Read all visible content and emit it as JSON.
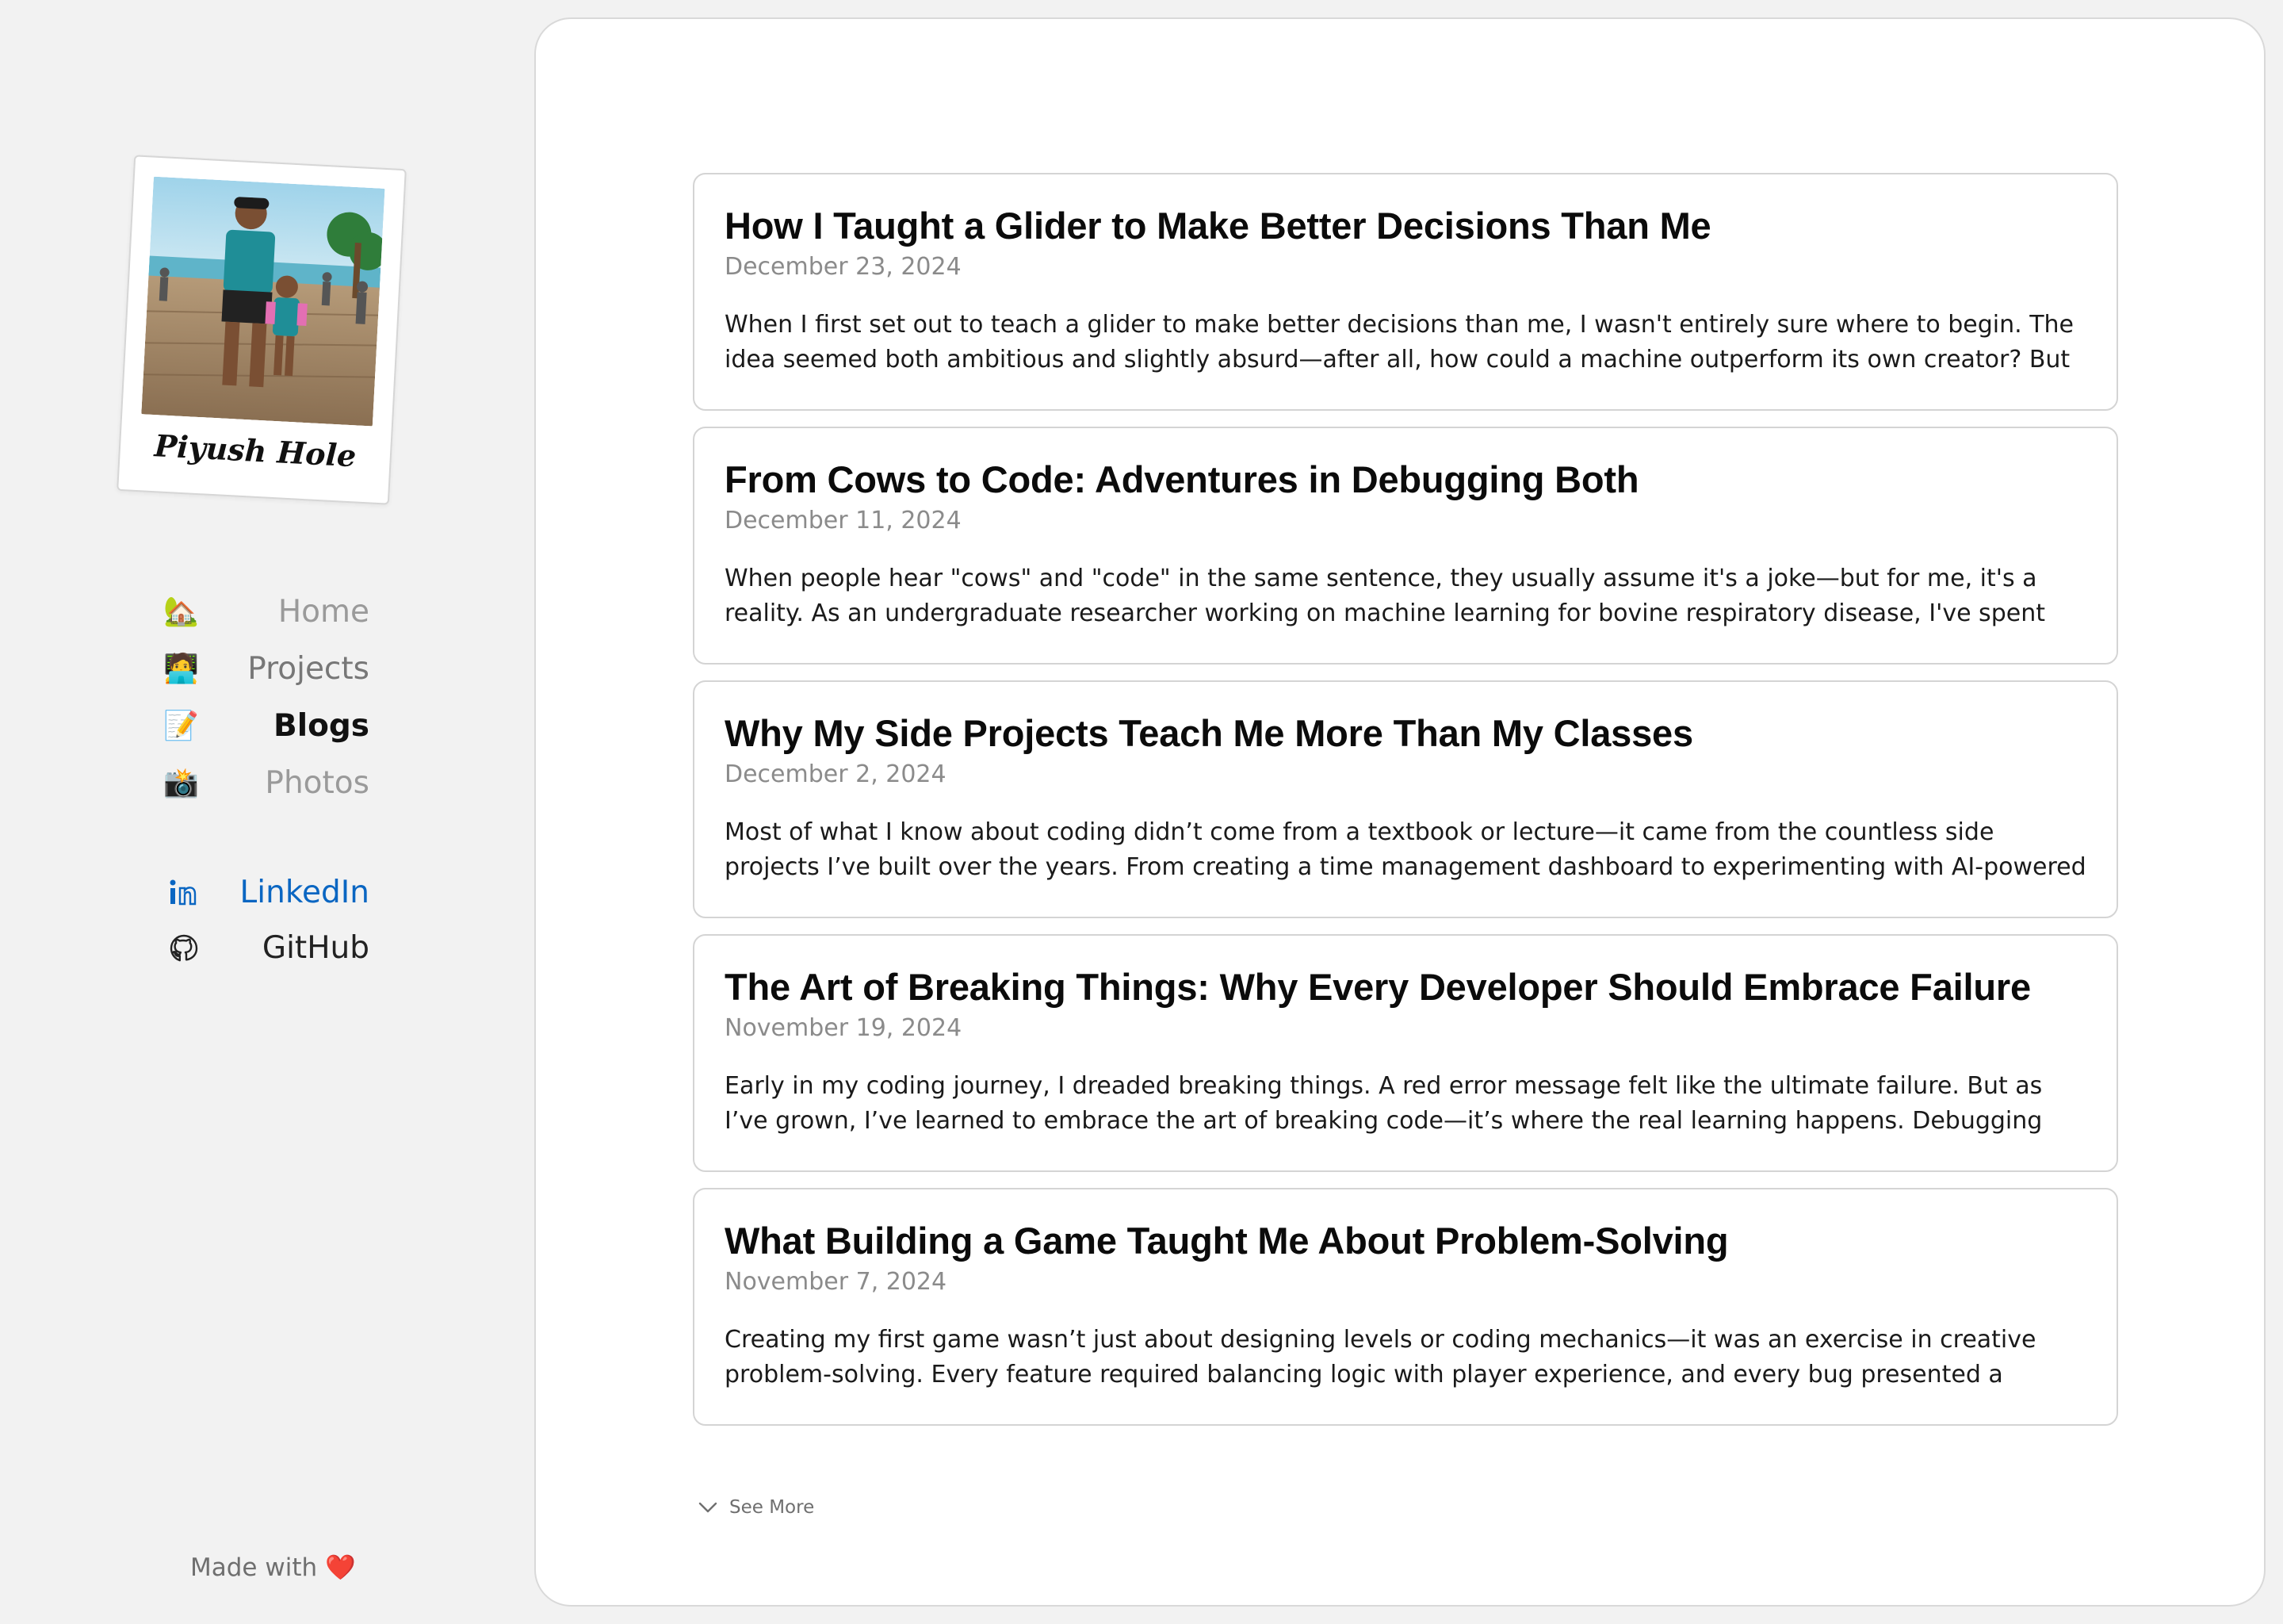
{
  "profile": {
    "caption": "Piyush Hole"
  },
  "nav": [
    {
      "emoji": "🏡",
      "label": "Home",
      "state": "muted-light"
    },
    {
      "emoji": "🧑‍💻",
      "label": "Projects",
      "state": "muted"
    },
    {
      "emoji": "📝",
      "label": "Blogs",
      "state": "active"
    },
    {
      "emoji": "📸",
      "label": "Photos",
      "state": "muted-light"
    }
  ],
  "socials": [
    {
      "icon": "linkedin-icon",
      "label": "LinkedIn",
      "color": "#0a66c2"
    },
    {
      "icon": "github-icon",
      "label": "GitHub",
      "color": "#222222"
    }
  ],
  "footer": {
    "made_with": "Made with",
    "heart": "❤️"
  },
  "posts": [
    {
      "title": "How I Taught a Glider to Make Better Decisions Than Me",
      "date": "December 23, 2024",
      "excerpt": "When I first set out to teach a glider to make better decisions than me, I wasn't entirely sure where to begin. The idea seemed both ambitious and slightly absurd—after all, how could a machine outperform its own creator? But as a..."
    },
    {
      "title": "From Cows to Code: Adventures in Debugging Both",
      "date": "December 11, 2024",
      "excerpt": "When people hear \"cows\" and \"code\" in the same sentence, they usually assume it's a joke—but for me, it's a reality. As an undergraduate researcher working on machine learning for bovine respiratory disease, I've spent hours debugging..."
    },
    {
      "title": "Why My Side Projects Teach Me More Than My Classes",
      "date": "December 2, 2024",
      "excerpt": "Most of what I know about coding didn’t come from a textbook or lecture—it came from the countless side projects I’ve built over the years. From creating a time management dashboard to experimenting with AI-powered chatbots, these..."
    },
    {
      "title": "The Art of Breaking Things: Why Every Developer Should Embrace Failure",
      "date": "November 19, 2024",
      "excerpt": "Early in my coding journey, I dreaded breaking things. A red error message felt like the ultimate failure. But as I’ve grown, I’ve learned to embrace the art of breaking code—it’s where the real learning happens. Debugging has taught..."
    },
    {
      "title": "What Building a Game Taught Me About Problem-Solving",
      "date": "November 7, 2024",
      "excerpt": "Creating my first game wasn’t just about designing levels or coding mechanics—it was an exercise in creative problem-solving. Every feature required balancing logic with player experience, and every bug presented a puzzle to solve..."
    }
  ],
  "see_more": "See More"
}
